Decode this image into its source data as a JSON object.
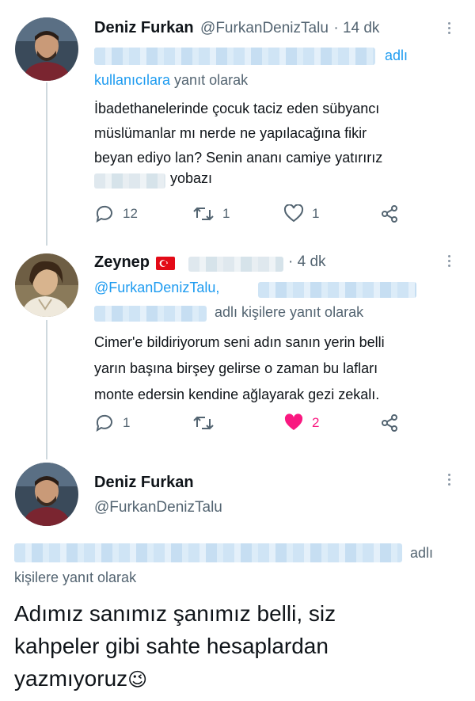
{
  "tweets": [
    {
      "name": "Deniz Furkan",
      "handle": "@FurkanDenizTalu",
      "time": "· 14 dk",
      "reply_suffix": "adlı",
      "reply_line2_users": "kullanıcılara",
      "reply_line2_rest": " yanıt olarak",
      "body_lines": [
        "İbadethanelerinde çocuk taciz eden sübyancı",
        "müslümanlar mı nerde ne yapılacağına fikir",
        "beyan ediyo lan? Senin ananı camiye yatırırız",
        "yobazı"
      ],
      "replies": "12",
      "retweets": "1",
      "likes": "1"
    },
    {
      "name": "Zeynep",
      "time": "· 4 dk",
      "reply_handle": "@FurkanDenizTalu,",
      "reply_suffix": "adlı kişilere yanıt olarak",
      "body_lines": [
        "Cimer'e bildiriyorum seni adın sanın yerin belli",
        "yarın başına birşey gelirse o zaman bu lafları",
        "monte edersin kendine ağlayarak gezi zekalı."
      ],
      "replies": "1",
      "retweets": "",
      "likes": "2"
    },
    {
      "name": "Deniz Furkan",
      "handle": "@FurkanDenizTalu",
      "reply_suffix": "adlı",
      "reply_line2": "kişilere yanıt olarak",
      "body_lines": [
        "Adımız sanımız şanımız belli, siz",
        "kahpeler gibi sahte hesaplardan",
        "yazmıyoruz"
      ],
      "emoji": "😉"
    }
  ],
  "colors": {
    "accent": "#1d9bf0",
    "like": "#f91880",
    "text": "#0f1419",
    "muted": "#536471"
  }
}
